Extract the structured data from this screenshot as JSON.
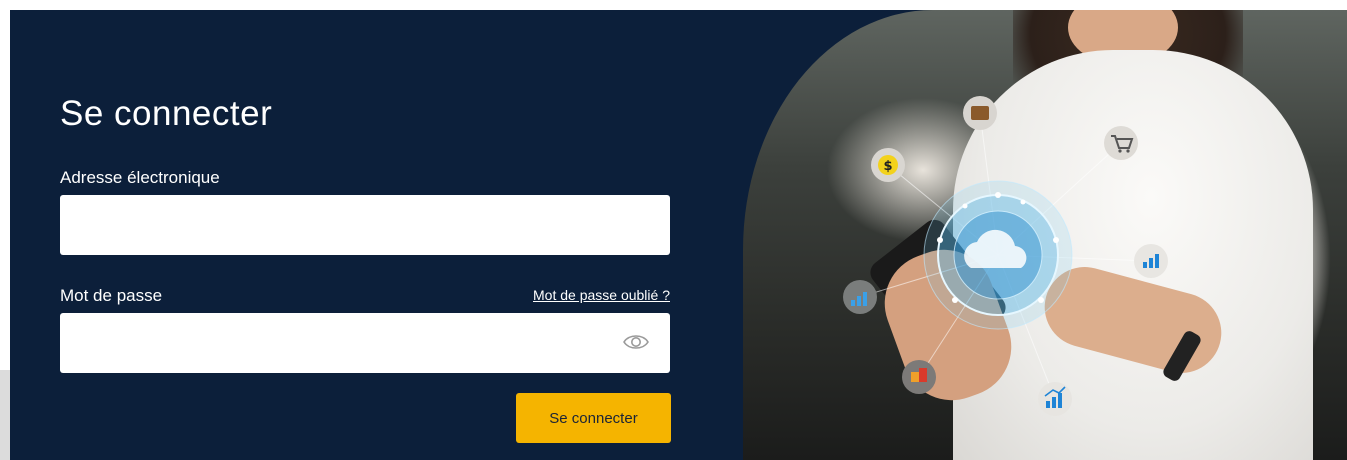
{
  "login": {
    "title": "Se connecter",
    "email_label": "Adresse électronique",
    "email_value": "",
    "password_label": "Mot de passe",
    "password_value": "",
    "forgot_password": "Mot de passe oublié ?",
    "submit_label": "Se connecter"
  },
  "icons": {
    "show_password": "eye-icon",
    "network": [
      "cloud-icon",
      "wallet-icon",
      "shopping-cart-icon",
      "dollar-icon",
      "bar-chart-icon",
      "growth-chart-icon",
      "box-icon",
      "trend-chart-icon"
    ]
  },
  "colors": {
    "panel_background": "#0c1f3a",
    "button_background": "#f5b400",
    "field_background": "#ffffff",
    "text": "#ffffff"
  }
}
